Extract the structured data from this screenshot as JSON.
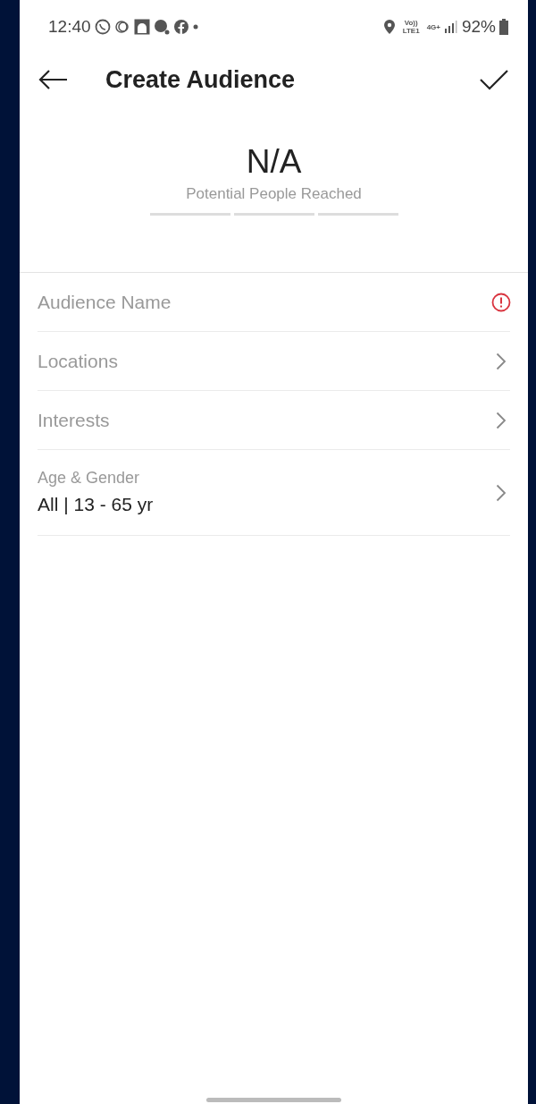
{
  "status_bar": {
    "time": "12:40",
    "network_labels": [
      "Vo))",
      "LTE1",
      "4G+"
    ],
    "battery": "92%"
  },
  "header": {
    "title": "Create Audience"
  },
  "reach": {
    "value": "N/A",
    "caption": "Potential People Reached"
  },
  "rows": [
    {
      "kind": "field",
      "label": "Audience Name",
      "error": true
    },
    {
      "kind": "link",
      "label": "Locations"
    },
    {
      "kind": "link",
      "label": "Interests"
    },
    {
      "kind": "link",
      "label": "Age & Gender",
      "value": "All | 13 - 65 yr"
    }
  ]
}
